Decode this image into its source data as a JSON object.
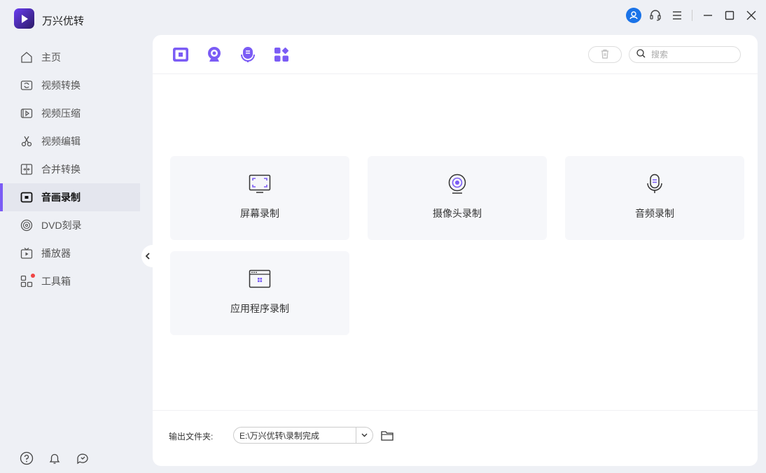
{
  "app": {
    "title": "万兴优转"
  },
  "titlebar": {
    "icons": [
      "user-icon",
      "headset-icon",
      "menu-icon",
      "minimize-icon",
      "maximize-icon",
      "close-icon"
    ]
  },
  "sidebar": {
    "items": [
      {
        "label": "主页",
        "icon": "home-icon"
      },
      {
        "label": "视频转换",
        "icon": "video-convert-icon"
      },
      {
        "label": "视频压缩",
        "icon": "video-compress-icon"
      },
      {
        "label": "视频编辑",
        "icon": "scissors-icon"
      },
      {
        "label": "合并转换",
        "icon": "merge-icon"
      },
      {
        "label": "音画录制",
        "icon": "record-icon",
        "active": true
      },
      {
        "label": "DVD刻录",
        "icon": "disc-icon"
      },
      {
        "label": "播放器",
        "icon": "tv-icon"
      },
      {
        "label": "工具箱",
        "icon": "toolbox-icon",
        "badge": true
      }
    ],
    "bottom_icons": [
      "help-icon",
      "bell-icon",
      "feedback-icon"
    ]
  },
  "toolbar": {
    "tools": [
      "screen-record-icon",
      "webcam-icon",
      "microphone-icon",
      "apps-icon"
    ],
    "search": {
      "placeholder": "搜索",
      "value": ""
    }
  },
  "cards": [
    {
      "label": "屏幕录制",
      "icon": "screen-icon"
    },
    {
      "label": "摄像头录制",
      "icon": "camera-icon"
    },
    {
      "label": "音频录制",
      "icon": "mic-icon"
    },
    {
      "label": "应用程序录制",
      "icon": "app-window-icon"
    }
  ],
  "footer": {
    "output_label": "输出文件夹:",
    "output_path": "E:\\万兴优转\\录制完成"
  },
  "colors": {
    "accent": "#7b5cf5",
    "badge": "#f04545",
    "user_avatar": "#1a73e8"
  }
}
